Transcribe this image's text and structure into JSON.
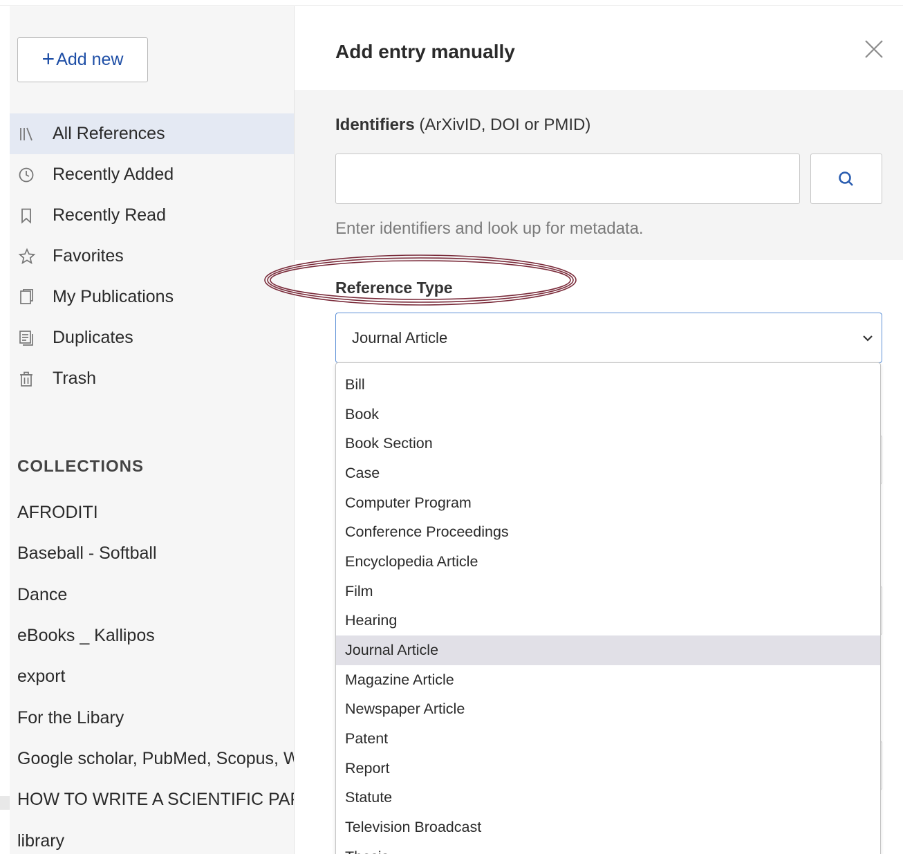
{
  "sidebar": {
    "add_new_label": "Add new",
    "nav": [
      {
        "label": "All References",
        "icon": "library-icon",
        "active": true
      },
      {
        "label": "Recently Added",
        "icon": "clock-icon"
      },
      {
        "label": "Recently Read",
        "icon": "bookmark-icon"
      },
      {
        "label": "Favorites",
        "icon": "star-icon"
      },
      {
        "label": "My Publications",
        "icon": "publication-icon"
      },
      {
        "label": "Duplicates",
        "icon": "duplicates-icon"
      },
      {
        "label": "Trash",
        "icon": "trash-icon"
      }
    ],
    "collections_title": "COLLECTIONS",
    "collections": [
      "AFRODITI",
      "Baseball - Softball",
      "Dance",
      "eBooks _ Kallipos",
      "export",
      "For the Libary",
      "Google scholar, PubMed, Scopus, Web of Science",
      "HOW TO WRITE A SCIENTIFIC PAPER",
      "library"
    ]
  },
  "panel": {
    "title": "Add entry manually",
    "identifiers_label_bold": "Identifiers",
    "identifiers_label_rest": " (ArXivID, DOI or PMID)",
    "identifiers_value": "",
    "identifiers_help": "Enter identifiers and look up for metadata.",
    "reference_type_label": "Reference Type",
    "reference_type_selected": "Journal Article",
    "highlight_color": "#7a2b3a",
    "reference_type_options": [
      "Bill",
      "Book",
      "Book Section",
      "Case",
      "Computer Program",
      "Conference Proceedings",
      "Encyclopedia Article",
      "Film",
      "Hearing",
      "Journal Article",
      "Magazine Article",
      "Newspaper Article",
      "Patent",
      "Report",
      "Statute",
      "Television Broadcast",
      "Thesis"
    ]
  }
}
